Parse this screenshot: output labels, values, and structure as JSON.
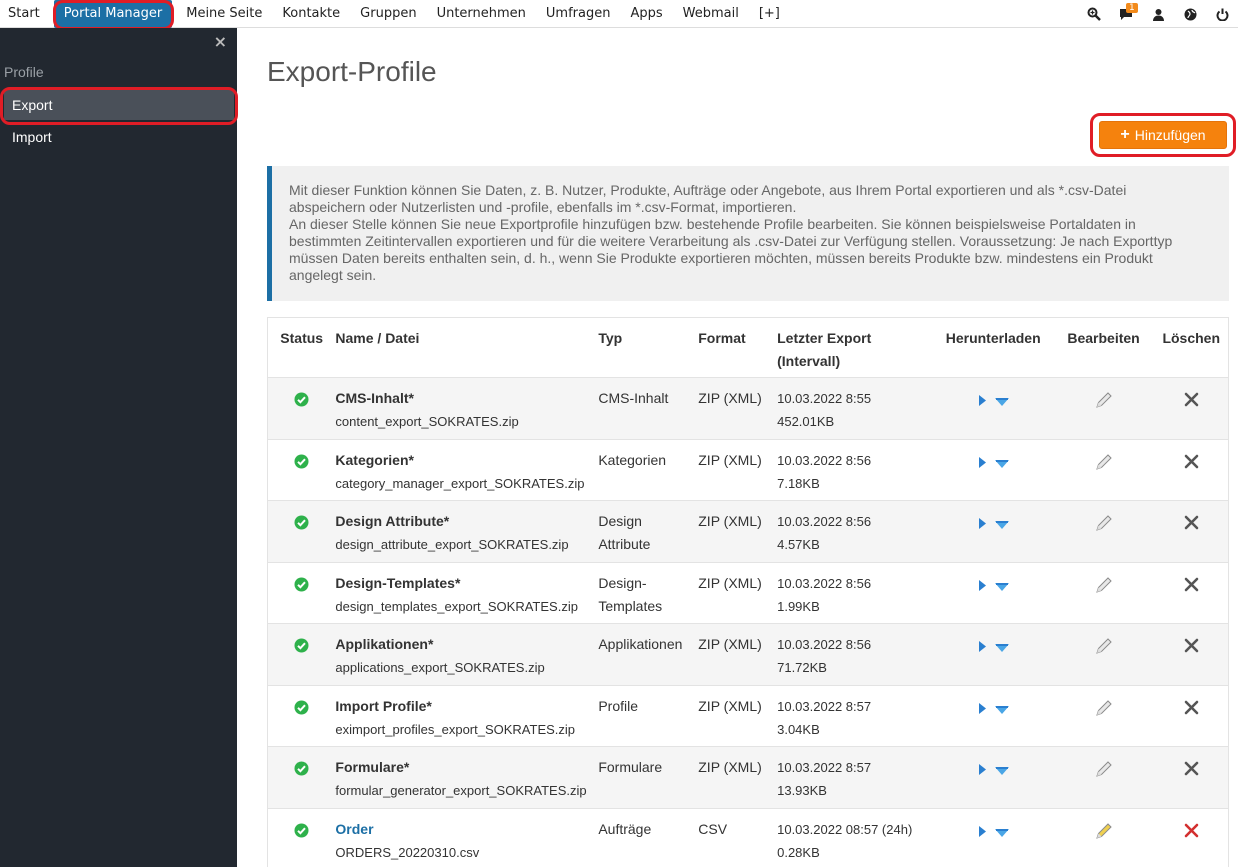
{
  "nav": {
    "items": [
      "Start",
      "Portal Manager",
      "Meine Seite",
      "Kontakte",
      "Gruppen",
      "Unternehmen",
      "Umfragen",
      "Apps",
      "Webmail",
      "[+]"
    ],
    "active_index": 1,
    "notification_count": "1"
  },
  "sidebar": {
    "close": "×",
    "heading": "Profile",
    "items": [
      {
        "label": "Export",
        "active": true
      },
      {
        "label": "Import",
        "active": false
      }
    ]
  },
  "main": {
    "title": "Export-Profile",
    "add_button": "Hinzufügen",
    "info_lines": [
      "Mit dieser Funktion können Sie Daten, z. B. Nutzer, Produkte, Aufträge oder Angebote, aus Ihrem Portal exportieren und als *.csv-Datei",
      "abspeichern oder Nutzerlisten und -profile, ebenfalls im *.csv-Format, importieren.",
      "An dieser Stelle können Sie neue Exportprofile hinzufügen bzw. bestehende Profile bearbeiten. Sie können beispielsweise Portaldaten in",
      "bestimmten Zeitintervallen exportieren und für die weitere Verarbeitung als .csv-Datei zur Verfügung stellen. Voraussetzung: Je nach Exporttyp",
      "müssen Daten bereits enthalten sein, d. h., wenn Sie Produkte exportieren möchten, müssen bereits Produkte bzw. mindestens ein Produkt",
      "angelegt sein."
    ]
  },
  "table": {
    "headers": {
      "status": "Status",
      "name": "Name / Datei",
      "typ": "Typ",
      "format": "Format",
      "export_1": "Letzter Export",
      "export_2": "(Intervall)",
      "download": "Herunterladen",
      "edit": "Bearbeiten",
      "delete": "Löschen"
    },
    "rows": [
      {
        "name": "CMS-Inhalt*",
        "file": "content_export_SOKRATES.zip",
        "typ_1": "CMS-Inhalt",
        "typ_2": "",
        "format": "ZIP (XML)",
        "date": "10.03.2022 8:55",
        "size": "452.01KB",
        "link": false
      },
      {
        "name": "Kategorien*",
        "file": "category_manager_export_SOKRATES.zip",
        "typ_1": "Kategorien",
        "typ_2": "",
        "format": "ZIP (XML)",
        "date": "10.03.2022 8:56",
        "size": "7.18KB",
        "link": false
      },
      {
        "name": "Design Attribute*",
        "file": "design_attribute_export_SOKRATES.zip",
        "typ_1": "Design",
        "typ_2": "Attribute",
        "format": "ZIP (XML)",
        "date": "10.03.2022 8:56",
        "size": "4.57KB",
        "link": false
      },
      {
        "name": "Design-Templates*",
        "file": "design_templates_export_SOKRATES.zip",
        "typ_1": "Design-",
        "typ_2": "Templates",
        "format": "ZIP (XML)",
        "date": "10.03.2022 8:56",
        "size": "1.99KB",
        "link": false
      },
      {
        "name": "Applikationen*",
        "file": "applications_export_SOKRATES.zip",
        "typ_1": "Applikationen",
        "typ_2": "",
        "format": "ZIP (XML)",
        "date": "10.03.2022 8:56",
        "size": "71.72KB",
        "link": false
      },
      {
        "name": "Import Profile*",
        "file": "eximport_profiles_export_SOKRATES.zip",
        "typ_1": "Profile",
        "typ_2": "",
        "format": "ZIP (XML)",
        "date": "10.03.2022 8:57",
        "size": "3.04KB",
        "link": false
      },
      {
        "name": "Formulare*",
        "file": "formular_generator_export_SOKRATES.zip",
        "typ_1": "Formulare",
        "typ_2": "",
        "format": "ZIP (XML)",
        "date": "10.03.2022 8:57",
        "size": "13.93KB",
        "link": false
      },
      {
        "name": "Order",
        "file": "ORDERS_20220310.csv",
        "typ_1": "Aufträge",
        "typ_2": "",
        "format": "CSV",
        "date": "10.03.2022 08:57 (24h)",
        "size": "0.28KB",
        "link": true
      }
    ]
  },
  "colors": {
    "accent": "#1c6fa5",
    "add_button": "#f5820d",
    "highlight": "#e01d26",
    "status_ok": "#2eb14b",
    "sidebar_bg": "#222830"
  },
  "icons": {
    "search": "search-icon",
    "chat": "chat-icon",
    "user": "user-icon",
    "globe": "globe-icon",
    "power": "power-icon",
    "status": "check-circle-icon",
    "play": "play-icon",
    "download": "download-icon",
    "edit": "pencil-icon",
    "delete": "x-icon"
  }
}
